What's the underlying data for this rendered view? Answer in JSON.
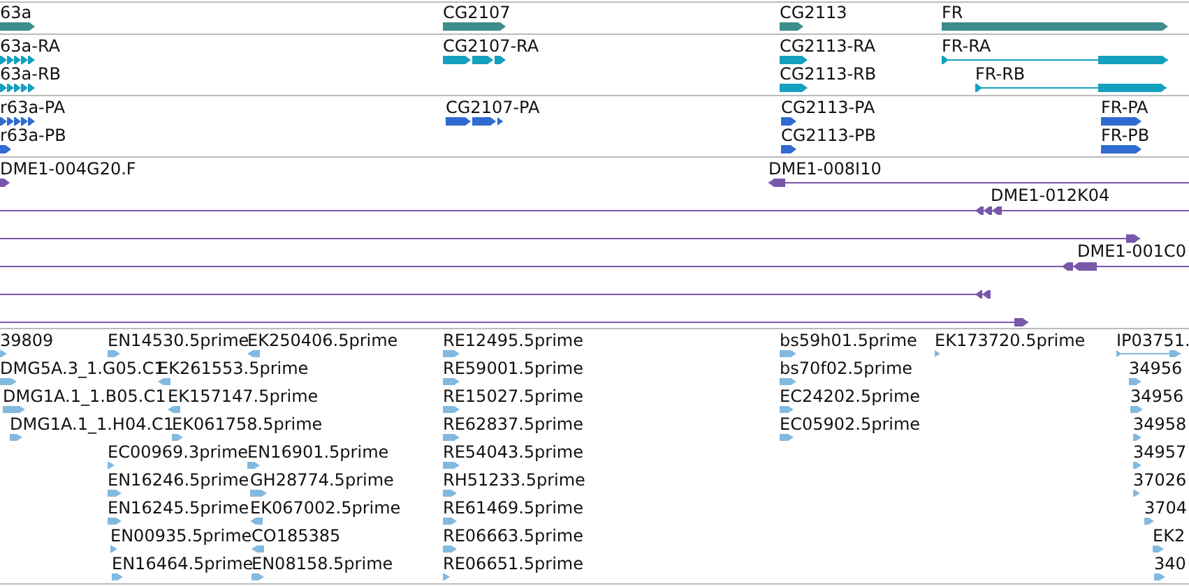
{
  "tracks": [
    {
      "kind": "gene",
      "features": [
        {
          "label": "63a"
        },
        {
          "label": "CG2107"
        },
        {
          "label": "CG2113"
        },
        {
          "label": "FR"
        }
      ]
    },
    {
      "kind": "transcript",
      "features": [
        {
          "label": "63a-RA"
        },
        {
          "label": "63a-RB"
        },
        {
          "label": "CG2107-RA"
        },
        {
          "label": "CG2113-RA"
        },
        {
          "label": "CG2113-RB"
        },
        {
          "label": "FR-RA"
        },
        {
          "label": "FR-RB"
        }
      ]
    },
    {
      "kind": "protein",
      "features": [
        {
          "label": "r63a-PA"
        },
        {
          "label": "r63a-PB"
        },
        {
          "label": "CG2107-PA"
        },
        {
          "label": "CG2113-PA"
        },
        {
          "label": "CG2113-PB"
        },
        {
          "label": "FR-PA"
        },
        {
          "label": "FR-PB"
        }
      ]
    },
    {
      "kind": "clone",
      "features": [
        {
          "label": "DME1-004G20.F",
          "reverse": false
        },
        {
          "label": "DME1-008I10",
          "reverse": true
        },
        {
          "label": "DME1-012K04",
          "reverse": true
        },
        {
          "reverse": false
        },
        {
          "label": "DME1-001C0",
          "reverse": true
        },
        {
          "reverse": true
        },
        {
          "reverse": false
        }
      ]
    },
    {
      "kind": "est",
      "features": [
        {
          "label": "39809",
          "reverse": false
        },
        {
          "label": "EN14530.5prime",
          "reverse": false
        },
        {
          "label": "EK250406.5prime",
          "reverse": true
        },
        {
          "label": "RE12495.5prime",
          "reverse": false
        },
        {
          "label": "bs59h01.5prime",
          "reverse": false
        },
        {
          "label": "EK173720.5prime",
          "reverse": false
        },
        {
          "label": "IP03751.",
          "reverse": false
        },
        {
          "label": "DMG5A.3_1.G05.C1",
          "reverse": false
        },
        {
          "label": "EK261553.5prime",
          "reverse": true
        },
        {
          "label": "RE59001.5prime",
          "reverse": false
        },
        {
          "label": "bs70f02.5prime",
          "reverse": false
        },
        {
          "label": "34956",
          "reverse": false
        },
        {
          "label": "DMG1A.1_1.B05.C1",
          "reverse": false
        },
        {
          "label": "EK157147.5prime",
          "reverse": true
        },
        {
          "label": "RE15027.5prime",
          "reverse": false
        },
        {
          "label": "EC24202.5prime",
          "reverse": false
        },
        {
          "label": "34956",
          "reverse": false
        },
        {
          "label": "DMG1A.1_1.H04.C1",
          "reverse": false
        },
        {
          "label": "EK061758.5prime",
          "reverse": false
        },
        {
          "label": "RE62837.5prime",
          "reverse": false
        },
        {
          "label": "EC05902.5prime",
          "reverse": false
        },
        {
          "label": "34958",
          "reverse": false
        },
        {
          "label": "EC00969.3prime",
          "reverse": false
        },
        {
          "label": "EN16901.5prime",
          "reverse": false
        },
        {
          "label": "RE54043.5prime",
          "reverse": false
        },
        {
          "label": "34957",
          "reverse": false
        },
        {
          "label": "EN16246.5prime",
          "reverse": false
        },
        {
          "label": "GH28774.5prime",
          "reverse": false
        },
        {
          "label": "RH51233.5prime",
          "reverse": false
        },
        {
          "label": "37026",
          "reverse": false
        },
        {
          "label": "EN16245.5prime",
          "reverse": false
        },
        {
          "label": "EK067002.5prime",
          "reverse": true
        },
        {
          "label": "RE61469.5prime",
          "reverse": false
        },
        {
          "label": "3704",
          "reverse": false
        },
        {
          "label": "EN00935.5prime",
          "reverse": false
        },
        {
          "label": "CO185385",
          "reverse": true
        },
        {
          "label": "RE06663.5prime",
          "reverse": false
        },
        {
          "label": "EK2",
          "reverse": false
        },
        {
          "label": "EN16464.5prime",
          "reverse": false
        },
        {
          "label": "EN08158.5prime",
          "reverse": false
        },
        {
          "label": "RE06651.5prime",
          "reverse": false
        },
        {
          "label": "340",
          "reverse": false
        }
      ]
    }
  ]
}
